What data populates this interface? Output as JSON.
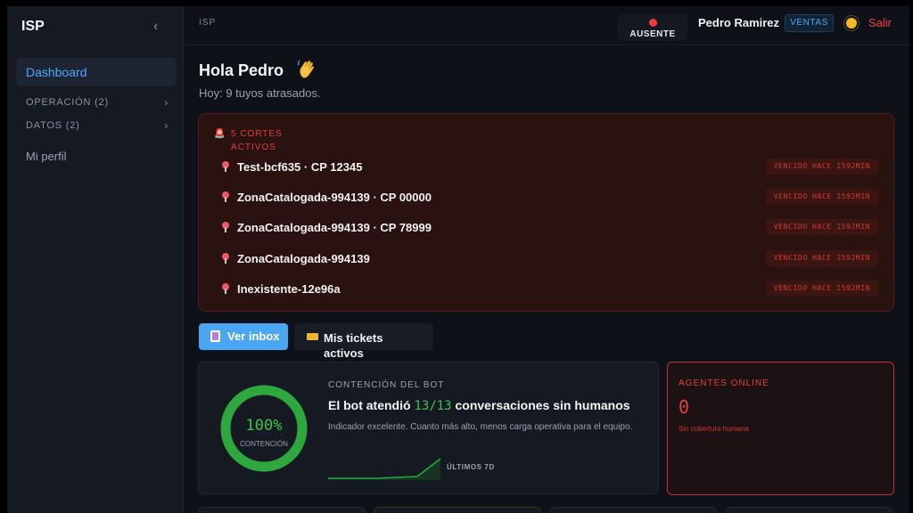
{
  "sidebar": {
    "brand": "ISP",
    "collapse_icon": "chevron-left-icon",
    "active_item": "Dashboard",
    "groups": [
      {
        "label": "OPERACIÓN (2)"
      },
      {
        "label": "DATOS (2)"
      }
    ],
    "profile_item": "Mi perfil"
  },
  "topbar": {
    "breadcrumb": "ISP",
    "status_label": "AUSENTE",
    "status_color": "#ef3b3b",
    "user_name": "Pedro Ramirez",
    "role": "VENTAS",
    "theme_icon": "sun-icon",
    "logout": "Salir"
  },
  "main": {
    "greeting": "Hola Pedro",
    "greeting_icon": "waving-hand-icon",
    "subtitle": "Hoy: 9 tuyos atrasados.",
    "outages": {
      "title": "5 CORTES ACTIVOS",
      "icon": "alarm-icon",
      "items": [
        {
          "label": "Test-bcf635 · CP 12345",
          "badge": "VENCIDO HACE 1592MIN"
        },
        {
          "label": "ZonaCatalogada-994139 · CP 00000",
          "badge": "VENCIDO HACE 1592MIN"
        },
        {
          "label": "ZonaCatalogada-994139 · CP 78999",
          "badge": "VENCIDO HACE 1592MIN"
        },
        {
          "label": "ZonaCatalogada-994139",
          "badge": "VENCIDO HACE 1592MIN"
        },
        {
          "label": "Inexistente-12e96a",
          "badge": "VENCIDO HACE 1592MIN"
        }
      ]
    },
    "actions": {
      "inbox": "Ver inbox",
      "tickets": "Mis tickets activos"
    },
    "bot": {
      "eyebrow": "CONTENCIÓN DEL BOT",
      "gauge_value": "100%",
      "gauge_fraction": 1.0,
      "gauge_caption": "CONTENCIÓN",
      "head_prefix": "El bot atendió",
      "handled": "13",
      "total": "13",
      "head_suffix": "conversaciones sin humanos",
      "description": "Indicador excelente. Cuanto más alto, menos carga operativa para el equipo.",
      "spark_label": "ÚLTIMOS 7D",
      "accent": "#3ec24e"
    },
    "agents": {
      "title": "AGENTES ONLINE",
      "count": "0",
      "note": "Sin cobertura humana",
      "accent": "#e2413b"
    }
  }
}
